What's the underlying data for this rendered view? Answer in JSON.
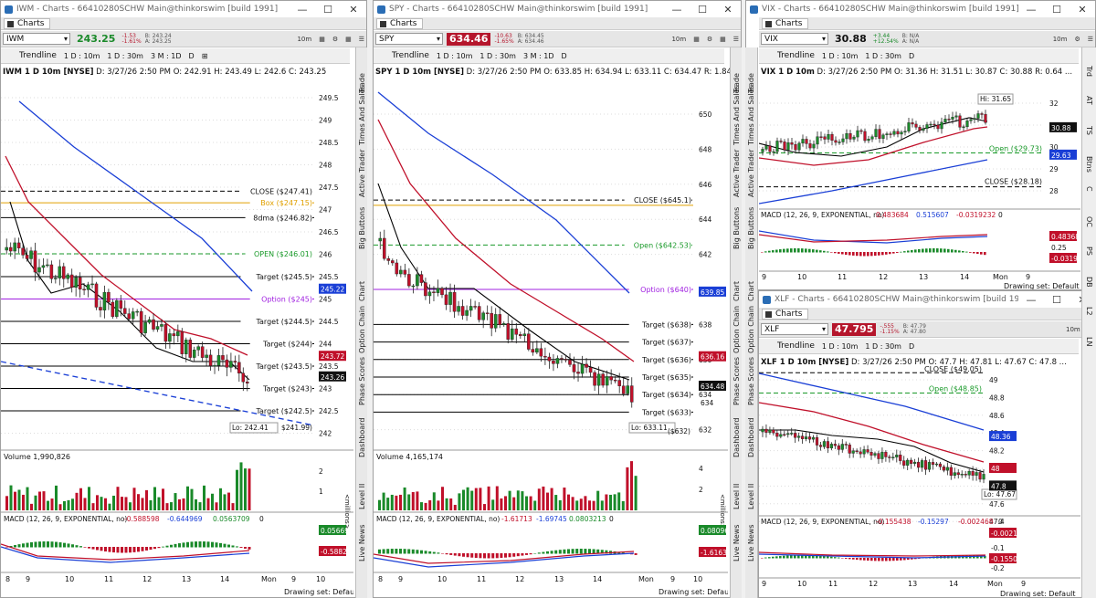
{
  "windows": {
    "iwm": {
      "title": "IWM - Charts - 66410280SCHW Main@thinkorswim [build 1991]",
      "symbol": "IWM",
      "price": "243.25",
      "chg1": "-1.53",
      "chg2": "-1.61%",
      "bid": "B: 243.24",
      "ask": "A: 243.25",
      "header_sym": "IWM 1 D 10m [NYSE]",
      "header_rest": "D: 3/27/26 2:50 PM   O: 242.91   H: 243.49   L: 242.6   C: 243.25",
      "volume": "Volume  1,990,826",
      "macd": "MACD (12, 26, 9, EXPONENTIAL, no)",
      "macd_v1": "-0.588598",
      "macd_v2": "-0.644969",
      "macd_v3": "0.0563709",
      "macd_v4": "0",
      "ticks": [
        "249.5",
        "249",
        "248.5",
        "248",
        "247.5",
        "247",
        "246.5",
        "246",
        "245.5",
        "245",
        "244.5",
        "244",
        "243.5",
        "243",
        "242.5",
        "242"
      ],
      "badges": {
        "blue": "245.22",
        "red": "243.72",
        "black": "243.26"
      },
      "levels": [
        "CLOSE ($247.41)",
        "Box ($247.15)",
        "8dma ($246.82)",
        "OPEN ($246.01)",
        "Target ($245.5)",
        "Option ($245)",
        "Target ($244.5)",
        "Target ($244)",
        "Target ($243.5)",
        "Target ($243)",
        "Target ($242.5)",
        "$241.99)"
      ],
      "lo": "Lo: 242.41",
      "macd_badges": {
        "green": "0.05669",
        "red": "-0.5882"
      },
      "xticks": [
        "8",
        "9",
        "10",
        "11",
        "12",
        "13",
        "14",
        "Mon",
        "9",
        "10"
      ]
    },
    "spy": {
      "title": "SPY - Charts - 66410280SCHW Main@thinkorswim [build 1991]",
      "symbol": "SPY",
      "price": "634.46",
      "chg1": "-10.63",
      "chg2": "-1.65%",
      "bid": "B: 634.45",
      "ask": "A: 634.46",
      "header_sym": "SPY 1 D 10m [NYSE]",
      "header_rest": "D: 3/27/26 2:50 PM   O: 633.85   H: 634.94   L: 633.11   C: 634.47   R: 1.84 ...",
      "volume": "Volume  4,165,174",
      "macd": "MACD (12, 26, 9, EXPONENTIAL, no)",
      "macd_v1": "-1.61713",
      "macd_v2": "-1.69745",
      "macd_v3": "0.0803213",
      "macd_v4": "0",
      "ticks": [
        "650",
        "648",
        "646",
        "644",
        "642",
        "640",
        "638",
        "636",
        "634",
        "632"
      ],
      "badges": {
        "blue": "639.85",
        "red": "636.16",
        "black": "634.48",
        "plain": "634"
      },
      "levels": [
        "CLOSE ($645.1)",
        "Open ($642.53)",
        "Option ($640)",
        "Target ($638)",
        "Target ($637)",
        "Target ($636)",
        "Target ($635)",
        "Target ($634)",
        "Target ($633)",
        "($632)"
      ],
      "lo": "Lo: 633.11",
      "macd_badges": {
        "green": "0.08096",
        "red": "-1.6163"
      },
      "xticks": [
        "8",
        "9",
        "10",
        "11",
        "12",
        "13",
        "14",
        "Mon",
        "9",
        "10"
      ]
    },
    "vix": {
      "title": "VIX - Charts - 66410280SCHW Main@thinkorswim [build 1991]",
      "symbol": "VIX",
      "price": "30.88",
      "chg1": "+3.44",
      "chg2": "+12.54%",
      "bid": "B: N/A",
      "ask": "A: N/A",
      "header_sym": "VIX 1 D 10m",
      "header_rest": "D: 3/27/26 2:50 PM   O: 31.36   H: 31.51   L: 30.87   C: 30.88   R: 0.64 ...",
      "macd": "MACD (12, 26, 9, EXPONENTIAL, no)",
      "macd_v1": "0.483684",
      "macd_v2": "0.515607",
      "macd_v3": "-0.0319232",
      "macd_v4": "0",
      "ticks": [
        "32",
        "31",
        "30",
        "29",
        "28"
      ],
      "badges": {
        "black": "30.88",
        "blue": "29.63"
      },
      "levels": [
        "Open ($29.73)",
        "CLOSE ($28.18)"
      ],
      "hi": "Hi: 31.65",
      "macd_badges": {
        "red1": "0.48368",
        "plain": "0.25",
        "red2": "-0.0319"
      },
      "xticks": [
        "9",
        "10",
        "11",
        "12",
        "13",
        "14",
        "Mon",
        "9"
      ]
    },
    "xlf": {
      "title": "XLF - Charts - 66410280SCHW Main@thinkorswim [build 1991]",
      "symbol": "XLF",
      "price": "47.795",
      "chg1": "-.555",
      "chg2": "-1.15%",
      "bid": "B: 47.79",
      "ask": "A: 47.80",
      "header_sym": "XLF 1 D 10m [NYSE]",
      "header_rest": "D: 3/27/26 2:50 PM   O: 47.7   H: 47.81   L: 47.67   C: 47.8 ...",
      "macd": "MACD (12, 26, 9, EXPONENTIAL, no)",
      "macd_v1": "-0.155438",
      "macd_v2": "-0.15297",
      "macd_v3": "-0.002468",
      "macd_v4": "0",
      "ticks": [
        "49",
        "48.8",
        "48.6",
        "48.4",
        "48.2",
        "48",
        "47.8",
        "47.6",
        "47.4"
      ],
      "badges": {
        "blue": "48.36",
        "red": "48",
        "black": "47.8"
      },
      "levels": [
        "CLOSE ($49.05)",
        "Open ($48.85)"
      ],
      "lo": "Lo: 47.67",
      "macd_badges": {
        "red1": "-0.0021",
        "plain": "-0.1",
        "red2": "-0.1550",
        "plain2": "-0.2"
      },
      "xticks": [
        "9",
        "10",
        "11",
        "12",
        "13",
        "14",
        "Mon",
        "9"
      ]
    }
  },
  "common": {
    "tab": "Charts",
    "trendline": "Trendline",
    "agg1": "1 D : 10m",
    "agg2": "1 D : 30m",
    "agg3": "3 M : 1D",
    "d": "D",
    "drawing_set": "Drawing set: Default",
    "millions": "<millions>",
    "agg_d10": "10m",
    "agg_d30": "30m",
    "style": "Style"
  },
  "left_side": [
    "Trade",
    "Times And Sales",
    "Active Trader",
    "Big Buttons",
    "Chart",
    "Option Chain",
    "Phase Scores",
    "Dashboard",
    "Level II",
    "Live News"
  ],
  "right_side": [
    "Trd",
    "AT",
    "TS",
    "Btns",
    "C",
    "OC",
    "PS",
    "DB",
    "L2",
    "LN"
  ],
  "colors": {
    "up": "#1a8a2a",
    "down": "#c0102a",
    "accent_blue": "#1a3fd6"
  }
}
